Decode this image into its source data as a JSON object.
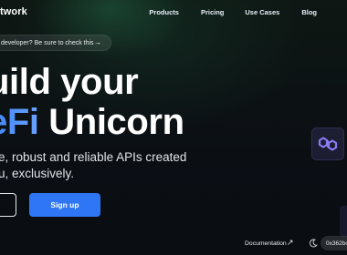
{
  "header": {
    "brand": "twork",
    "nav": [
      "Products",
      "Pricing",
      "Use Cases",
      "Blog"
    ]
  },
  "announcement": {
    "text": "developer? Be sure to check this",
    "arrow": "→"
  },
  "hero": {
    "title_line1": "uild your",
    "title_line2_accent": "eFi",
    "title_line2_rest": " Unicorn",
    "subtext_line1": "e, robust and reliable APIs created",
    "subtext_line2": "u, exclusively."
  },
  "buttons": {
    "signup": "Sign up"
  },
  "footer": {
    "documentation": "Documentation",
    "doc_arrow": "↗",
    "wallet": "0x362bc"
  },
  "colors": {
    "accent": "#2f76f6",
    "background": "#0b0e14",
    "icon_tint": "#8b7cf6"
  },
  "icons": [
    "arrow-right-icon",
    "polygon-icon",
    "external-link-icon",
    "moon-icon"
  ]
}
